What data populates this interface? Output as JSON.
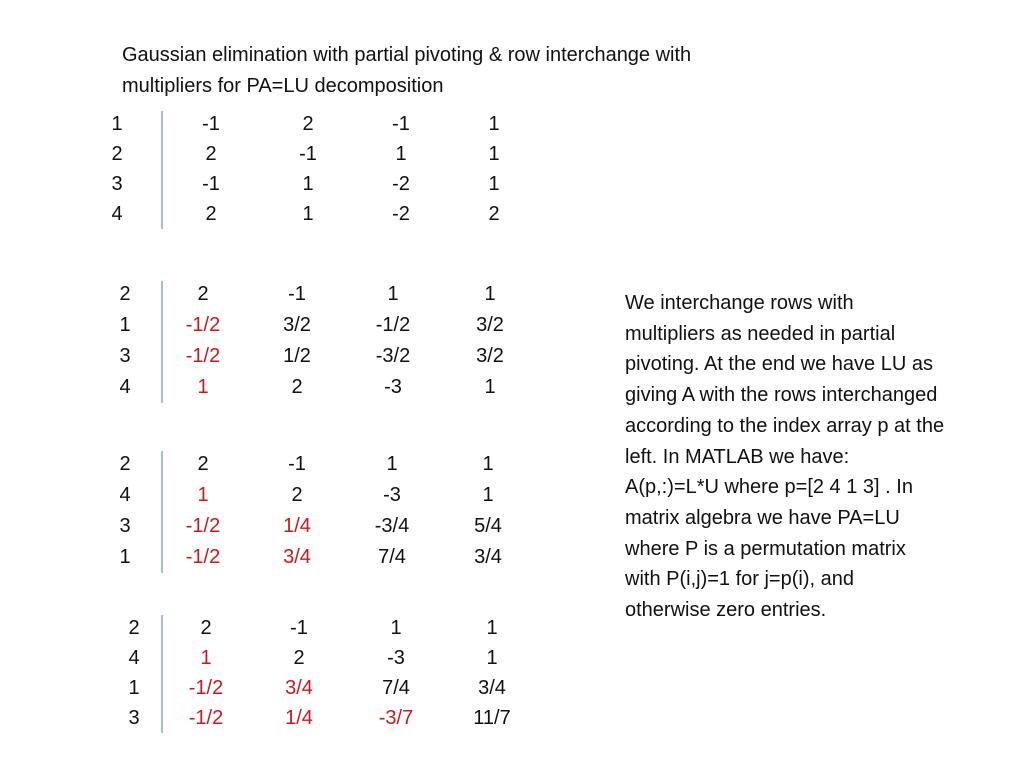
{
  "title": "Gaussian elimination with partial pivoting & row interchange  with multipliers for PA=LU decomposition",
  "colors": {
    "multiplier": "#d0161b",
    "text": "#111111",
    "divider": "#a7bccd"
  },
  "matrices": [
    {
      "name": "initial",
      "rows": [
        {
          "index": "1",
          "cells": [
            {
              "v": "-1",
              "red": false
            },
            {
              "v": "2",
              "red": false
            },
            {
              "v": "-1",
              "red": false
            },
            {
              "v": "1",
              "red": false
            }
          ]
        },
        {
          "index": "2",
          "cells": [
            {
              "v": "2",
              "red": false
            },
            {
              "v": "-1",
              "red": false
            },
            {
              "v": "1",
              "red": false
            },
            {
              "v": "1",
              "red": false
            }
          ]
        },
        {
          "index": "3",
          "cells": [
            {
              "v": "-1",
              "red": false
            },
            {
              "v": "1",
              "red": false
            },
            {
              "v": "-2",
              "red": false
            },
            {
              "v": "1",
              "red": false
            }
          ]
        },
        {
          "index": "4",
          "cells": [
            {
              "v": "2",
              "red": false
            },
            {
              "v": "1",
              "red": false
            },
            {
              "v": "-2",
              "red": false
            },
            {
              "v": "2",
              "red": false
            }
          ]
        }
      ]
    },
    {
      "name": "step-1",
      "rows": [
        {
          "index": "2",
          "cells": [
            {
              "v": "2",
              "red": false
            },
            {
              "v": "-1",
              "red": false
            },
            {
              "v": "1",
              "red": false
            },
            {
              "v": "1",
              "red": false
            }
          ]
        },
        {
          "index": "1",
          "cells": [
            {
              "v": "-1/2",
              "red": true
            },
            {
              "v": "3/2",
              "red": false
            },
            {
              "v": "-1/2",
              "red": false
            },
            {
              "v": "3/2",
              "red": false
            }
          ]
        },
        {
          "index": "3",
          "cells": [
            {
              "v": "-1/2",
              "red": true
            },
            {
              "v": "1/2",
              "red": false
            },
            {
              "v": "-3/2",
              "red": false
            },
            {
              "v": "3/2",
              "red": false
            }
          ]
        },
        {
          "index": "4",
          "cells": [
            {
              "v": "1",
              "red": true
            },
            {
              "v": "2",
              "red": false
            },
            {
              "v": "-3",
              "red": false
            },
            {
              "v": "1",
              "red": false
            }
          ]
        }
      ]
    },
    {
      "name": "step-2",
      "rows": [
        {
          "index": "2",
          "cells": [
            {
              "v": "2",
              "red": false
            },
            {
              "v": "-1",
              "red": false
            },
            {
              "v": "1",
              "red": false
            },
            {
              "v": "1",
              "red": false
            }
          ]
        },
        {
          "index": "4",
          "cells": [
            {
              "v": "1",
              "red": true
            },
            {
              "v": "2",
              "red": false
            },
            {
              "v": "-3",
              "red": false
            },
            {
              "v": "1",
              "red": false
            }
          ]
        },
        {
          "index": "3",
          "cells": [
            {
              "v": "-1/2",
              "red": true
            },
            {
              "v": "1/4",
              "red": true
            },
            {
              "v": "-3/4",
              "red": false
            },
            {
              "v": "5/4",
              "red": false
            }
          ]
        },
        {
          "index": "1",
          "cells": [
            {
              "v": "-1/2",
              "red": true
            },
            {
              "v": "3/4",
              "red": true
            },
            {
              "v": "7/4",
              "red": false
            },
            {
              "v": "3/4",
              "red": false
            }
          ]
        }
      ]
    },
    {
      "name": "step-3",
      "rows": [
        {
          "index": "2",
          "cells": [
            {
              "v": "2",
              "red": false
            },
            {
              "v": "-1",
              "red": false
            },
            {
              "v": "1",
              "red": false
            },
            {
              "v": "1",
              "red": false
            }
          ]
        },
        {
          "index": "4",
          "cells": [
            {
              "v": "1",
              "red": true
            },
            {
              "v": "2",
              "red": false
            },
            {
              "v": "-3",
              "red": false
            },
            {
              "v": "1",
              "red": false
            }
          ]
        },
        {
          "index": "1",
          "cells": [
            {
              "v": "-1/2",
              "red": true
            },
            {
              "v": "3/4",
              "red": true
            },
            {
              "v": "7/4",
              "red": false
            },
            {
              "v": "3/4",
              "red": false
            }
          ]
        },
        {
          "index": "3",
          "cells": [
            {
              "v": "-1/2",
              "red": true
            },
            {
              "v": "1/4",
              "red": true
            },
            {
              "v": "-3/7",
              "red": true
            },
            {
              "v": "11/7",
              "red": false
            }
          ]
        }
      ]
    }
  ],
  "note": "We interchange rows with multipliers as needed in partial pivoting. At the end we have LU as giving A with the rows interchanged according to the index array p at the left. In MATLAB we have: A(p,:)=L*U where p=[2 4 1 3] . In matrix algebra we have PA=LU where P is a permutation matrix with P(i,j)=1 for j=p(i), and otherwise zero entries."
}
